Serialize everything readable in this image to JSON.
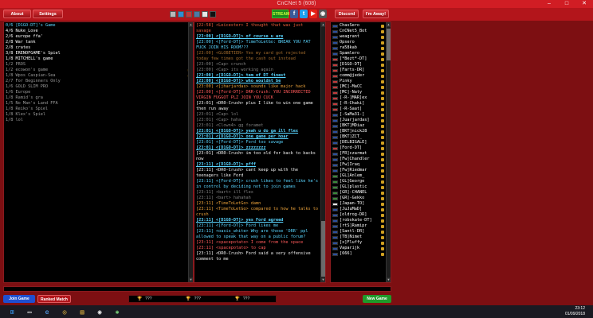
{
  "window": {
    "title": "CnCNet 5 (608)"
  },
  "toolbar": {
    "about_label": "About",
    "settings_label": "Settings",
    "stream_label": "STREAM",
    "discord_label": "Discord",
    "away_label": "I'm Away!",
    "swatches": [
      "#b8b8b8",
      "#2d8fd5",
      "#c43a3a",
      "#4a7aa8",
      "#e6e6e6",
      "#111111"
    ]
  },
  "channels": [
    {
      "name": "0/6 [D1GO-DT]'s Game",
      "state": "sel",
      "locked": false
    },
    {
      "name": "4/6 Nuke_Love",
      "state": "joined",
      "locked": false
    },
    {
      "name": "2/6 europe ffa'",
      "state": "joined",
      "locked": false
    },
    {
      "name": "2/8 War tank",
      "state": "joined",
      "locked": false
    },
    {
      "name": "2/8 crates",
      "state": "joined",
      "locked": false
    },
    {
      "name": "3/8 ERENOFGAME's Spiel",
      "state": "joined",
      "locked": false
    },
    {
      "name": "1/8 MITCHELL's game",
      "state": "joined",
      "locked": false
    },
    {
      "name": "1/2 PROS",
      "state": "",
      "locked": false
    },
    {
      "name": "1/2 ecowon's game",
      "state": "",
      "locked": true
    },
    {
      "name": "1/8 Wpos Caspian-Sea",
      "state": "",
      "locked": true
    },
    {
      "name": "2/7 For Beginners Only",
      "state": "",
      "locked": false
    },
    {
      "name": "1/6 GOLD SLIM PRO",
      "state": "",
      "locked": false
    },
    {
      "name": "1/6 Europe",
      "state": "",
      "locked": false
    },
    {
      "name": "1/8 Ramid's gra",
      "state": "",
      "locked": false
    },
    {
      "name": "1/5 No Man's Land FFA",
      "state": "",
      "locked": false
    },
    {
      "name": "1/8 Reiko's Spiel",
      "state": "",
      "locked": false
    },
    {
      "name": "1/8 Klex's Spiel",
      "state": "",
      "locked": false
    },
    {
      "name": "1/8 lol",
      "state": "",
      "locked": false
    }
  ],
  "chat": [
    {
      "t": "[22:58] <Leicester> I thought that was just savage",
      "c": "#e85a3a"
    },
    {
      "t": "[23:00] <[D1GO-DT]> of course u are",
      "c": "#59d5ff",
      "u": true
    },
    {
      "t": "[23:00] <[Ford-DT]> TimeToLetGo: BREAK YOU FAT FUCK JOIN HIS ROOM???",
      "c": "#59d5ff"
    },
    {
      "t": "[23:00] <GLOBETIER> Yes my card got rejected today few times got the cash out instead",
      "c": "#a06a2c"
    },
    {
      "t": "[23:00] <Cap> crunch",
      "c": "#7f7f7f"
    },
    {
      "t": "[23:00] <Cap> its working again",
      "c": "#7f7f7f"
    },
    {
      "t": "[23:00] <[D1GO-DT]> tem of DT finest",
      "c": "#59d5ff",
      "u": true
    },
    {
      "t": "[23:00] <[D1GO-DT]> who wouldnt be",
      "c": "#59d5ff",
      "u": true
    },
    {
      "t": "[23:00] <[jharjardas> sounds like major hack",
      "c": "#e8a03a"
    },
    {
      "t": "[23:00] <[Ford-DT]> DRR-Crush: YOU INCORRECTED VIRGIN FUGGOT PLZ JOIN YOU CUCK",
      "c": "#ff5a5a"
    },
    {
      "t": "[23:01] <DR0-Crush> plus I like to win one game then run away",
      "c": "#f0f0f0"
    },
    {
      "t": "[23:01] <Cap> lol",
      "c": "#7f7f7f"
    },
    {
      "t": "[23:01] <Cap> haha",
      "c": "#7f7f7f"
    },
    {
      "t": "[23:01] <Clown4> gg foramet",
      "c": "#7f7f7f"
    },
    {
      "t": "[23:01] <[D1GO-DT]> yeah u do ga ill flex",
      "c": "#59d5ff",
      "u": true
    },
    {
      "t": "[23:01] <[D1GO-DT]> one game per hoar",
      "c": "#59d5ff",
      "u": true
    },
    {
      "t": "[23:01] <[Ford-DT]> Ford too savage",
      "c": "#59d5ff"
    },
    {
      "t": "[23:01] <[D1GO-DT]> zzzzzzzz",
      "c": "#59d5ff",
      "u": true
    },
    {
      "t": "[23:01] <DR0-Crush> im too old for back to backs now",
      "c": "#f0f0f0"
    },
    {
      "t": "[23:11] <[D1GO-DT]> pfff",
      "c": "#59d5ff",
      "u": true
    },
    {
      "t": "[23:11] <DR0-Crush> cant keep up with the teenagers like Ford",
      "c": "#f0f0f0"
    },
    {
      "t": "[23:11] <[Ford-DT]> crush likes to feel like he's in control by deciding not to join games",
      "c": "#59d5ff"
    },
    {
      "t": "[23:11] <bart> ill flex",
      "c": "#7f7f7f"
    },
    {
      "t": "[23:11] <bart> hahahah",
      "c": "#7f7f7f"
    },
    {
      "t": "[23:11] <TimeToLetGo> damn",
      "c": "#e8a03a"
    },
    {
      "t": "[23:11] <TimeToLetGo> compared to how he talks to crush",
      "c": "#e8a03a"
    },
    {
      "t": "[23:11] <[D1GO-DT]> yes Ford agreed",
      "c": "#59d5ff",
      "u": true
    },
    {
      "t": "[23:11] <[Ford-DT]> Ford likes me",
      "c": "#59d5ff"
    },
    {
      "t": "[23:11] <oasis_white> Why are those 'DRR' ppl allowed to speak that way on a public forum?",
      "c": "#59d5ff"
    },
    {
      "t": "[23:11] <spacepotato> I come from the space",
      "c": "#ff5a5a"
    },
    {
      "t": "[23:11] <spacepotato> to cap",
      "c": "#ff5a5a"
    },
    {
      "t": "[23:11] <DR0-Crush> Ford said a very offensive comment to me",
      "c": "#f0f0f0"
    }
  ],
  "users": [
    {
      "name": "ChasSero",
      "flag": "#2b4f9e"
    },
    {
      "name": "CnCNet5_Bot",
      "flag": "#2b4f9e"
    },
    {
      "name": "weagrant",
      "flag": "#2b4f9e"
    },
    {
      "name": "Opsero",
      "flag": "#2b4f9e"
    },
    {
      "name": "ra58kab",
      "flag": "#2b4f9e"
    },
    {
      "name": "Spamlero",
      "flag": "#2b4f9e"
    },
    {
      "name": "[*Bezt*-DT]",
      "flag": "#c23a3a"
    },
    {
      "name": "[D1GO-DT]",
      "flag": "#c23a3a"
    },
    {
      "name": "[Farts-DR]",
      "flag": "#c23a3a"
    },
    {
      "name": "comm@jeder",
      "flag": "#c23a3a"
    },
    {
      "name": "Pinky",
      "flag": "#c23a3a"
    },
    {
      "name": "[MC]-MaCC",
      "flag": "#c23a3a"
    },
    {
      "name": "[MC]-Naty",
      "flag": "#c23a3a"
    },
    {
      "name": "[-R-]MAR]ex",
      "flag": "#c23a3a"
    },
    {
      "name": "[-R-Chaki]",
      "flag": "#c23a3a"
    },
    {
      "name": "[-R-Saat]",
      "flag": "#c23a3a"
    },
    {
      "name": "[-SaMa31-]",
      "flag": "#2b4f9e"
    },
    {
      "name": "[Juarjardas]",
      "flag": "#2b4f9e"
    },
    {
      "name": "[BKT]MDiaz",
      "flag": "#2b4f9e"
    },
    {
      "name": "[BKT]nick28",
      "flag": "#2b4f9e"
    },
    {
      "name": "[BKT]ZCT_",
      "flag": "#2b4f9e"
    },
    {
      "name": "[DELBIGALE]",
      "flag": "#2b4f9e"
    },
    {
      "name": "[Ford-DT]",
      "flag": "#c23a3a"
    },
    {
      "name": "[FR]czarmat",
      "flag": "#2b4f9e"
    },
    {
      "name": "[Fw]Chandler",
      "flag": "#2b4f9e"
    },
    {
      "name": "[Fw]Iraq",
      "flag": "#2b4f9e"
    },
    {
      "name": "[Fw]Riedmar",
      "flag": "#2b4f9e"
    },
    {
      "name": "[GL]Anlem_",
      "flag": "#3a8a3a"
    },
    {
      "name": "[GL]George",
      "flag": "#3a8a3a"
    },
    {
      "name": "[GL]plastic",
      "flag": "#3a8a3a"
    },
    {
      "name": "[GR]-CHANEL",
      "flag": "#3a8a3a"
    },
    {
      "name": "[GR]-Gekko",
      "flag": "#3a8a3a"
    },
    {
      "name": "[Japan-TO]",
      "flag": "#e6e6e6"
    },
    {
      "name": "[JuJuMaD]",
      "flag": "#2b4f9e"
    },
    {
      "name": "[oldrog-DR]",
      "flag": "#2b4f9e"
    },
    {
      "name": "[robskate-DT]",
      "flag": "#2b4f9e"
    },
    {
      "name": "[rtS]Ramipr",
      "flag": "#2b4f9e"
    },
    {
      "name": "[Santl-DR]",
      "flag": "#2b4f9e"
    },
    {
      "name": "[TB]Nimet",
      "flag": "#2b4f9e"
    },
    {
      "name": "[x]Fluffy",
      "flag": "#2b4f9e"
    },
    {
      "name": "Vaparijk",
      "flag": "#2b4f9e"
    },
    {
      "name": "[666]",
      "flag": "#2b4f9e"
    }
  ],
  "bottom": {
    "join_label": "Join Game",
    "ranked_label": "Ranked Match",
    "new_label": "New Game",
    "ladder": [
      "???",
      "???",
      "???"
    ]
  },
  "taskbar": {
    "time": "23:12",
    "date": "01/09/2018"
  }
}
